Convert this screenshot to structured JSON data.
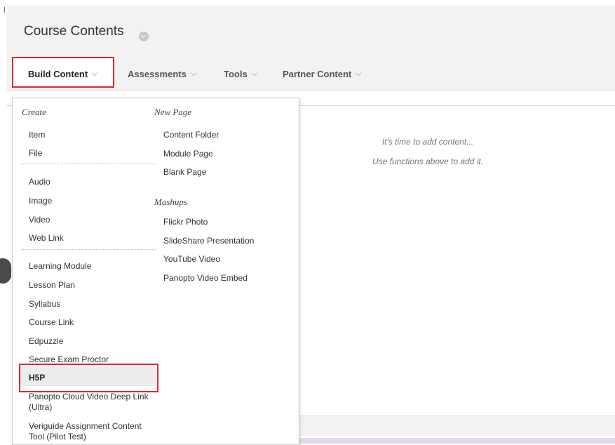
{
  "header": {
    "title": "Course Contents"
  },
  "toolbar": {
    "build_content": "Build Content",
    "assessments": "Assessments",
    "tools": "Tools",
    "partner_content": "Partner Content"
  },
  "empty_state": {
    "line1": "It's time to add content...",
    "line2": "Use functions above to add it."
  },
  "menu": {
    "create_heading": "Create",
    "new_page_heading": "New Page",
    "mashups_heading": "Mashups",
    "create_items": [
      "Item",
      "File"
    ],
    "media_items": [
      "Audio",
      "Image",
      "Video",
      "Web Link"
    ],
    "module_items": [
      "Learning Module",
      "Lesson Plan",
      "Syllabus",
      "Course Link",
      "Edpuzzle",
      "Secure Exam Proctor",
      "H5P",
      "Panopto Cloud Video Deep Link (Ultra)",
      "Veriguide Assignment Content Tool (Pilot Test)"
    ],
    "new_page_items": [
      "Content Folder",
      "Module Page",
      "Blank Page"
    ],
    "mashup_items": [
      "Flickr Photo",
      "SlideShare Presentation",
      "YouTube Video",
      "Panopto Video Embed"
    ]
  },
  "colors": {
    "highlight": "#e0282e",
    "toolbar_bg": "#f2f2f2"
  }
}
